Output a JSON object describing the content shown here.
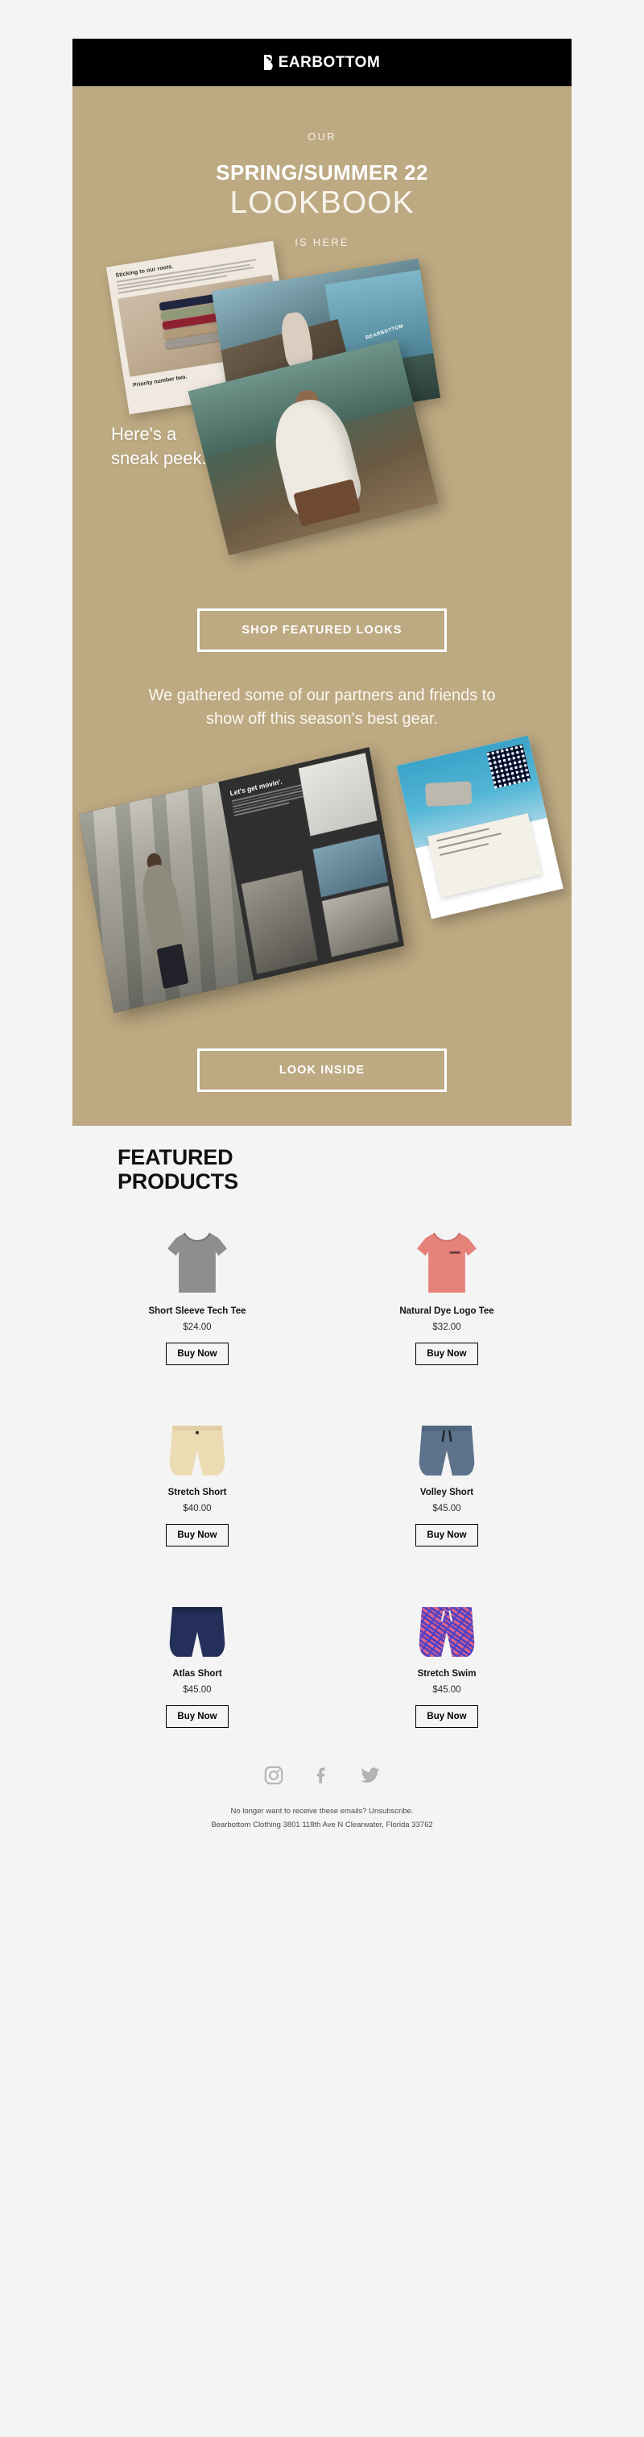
{
  "brand": {
    "logo_text": "EARBOTTOM",
    "logo_full": "BEARBOTTOM",
    "logo_icon": "bear-mark-icon",
    "bar_color": "#000000",
    "hero_bg": "#bda982",
    "page_bg": "#f4f4f4"
  },
  "hero": {
    "eyebrow": "OUR",
    "title_line1": "SPRING/SUMMER 22",
    "title_line2": "LOOKBOOK",
    "subline": "IS HERE",
    "sneak_peek_line1": "Here's a",
    "sneak_peek_line2": "sneak peek.",
    "cta_primary": "SHOP FEATURED LOOKS",
    "paragraph": "We gathered some of our partners and friends to show off this season's best gear.",
    "cta_secondary": "LOOK INSIDE"
  },
  "lookbook_image_1": {
    "alt": "Spring Summer 22 lookbook pages fanned out on tan background",
    "page_headline": "Sticking to our roots.",
    "page_headline_2": "Priority number two."
  },
  "lookbook_image_2": {
    "alt": "Open lookbook spread with back cover and QR code",
    "spread_headline": "Let's get movin'."
  },
  "featured": {
    "heading_line1": "FEATURED",
    "heading_line2": "PRODUCTS",
    "buy_label": "Buy Now",
    "products": [
      {
        "name": "Short Sleeve Tech Tee",
        "price": "$24.00",
        "type": "tee",
        "color": "#8e8f8d"
      },
      {
        "name": "Natural Dye Logo Tee",
        "price": "$32.00",
        "type": "tee",
        "color": "#e7827b"
      },
      {
        "name": "Stretch Short",
        "price": "$40.00",
        "type": "short",
        "color": "#ecdcb4"
      },
      {
        "name": "Volley Short",
        "price": "$45.00",
        "type": "short",
        "color": "#5d738c"
      },
      {
        "name": "Atlas Short",
        "price": "$45.00",
        "type": "short",
        "color": "#24305a"
      },
      {
        "name": "Stretch Swim",
        "price": "$45.00",
        "type": "short",
        "color": "#d9628f"
      }
    ]
  },
  "footer": {
    "social": [
      {
        "name": "instagram-icon",
        "label": "Instagram"
      },
      {
        "name": "facebook-icon",
        "label": "Facebook"
      },
      {
        "name": "twitter-icon",
        "label": "Twitter"
      }
    ],
    "legal_line1": "No longer want to receive these emails? Unsubscribe.",
    "legal_line2": "Bearbottom Clothing 3801 118th Ave N Clearwater, Florida 33762"
  }
}
